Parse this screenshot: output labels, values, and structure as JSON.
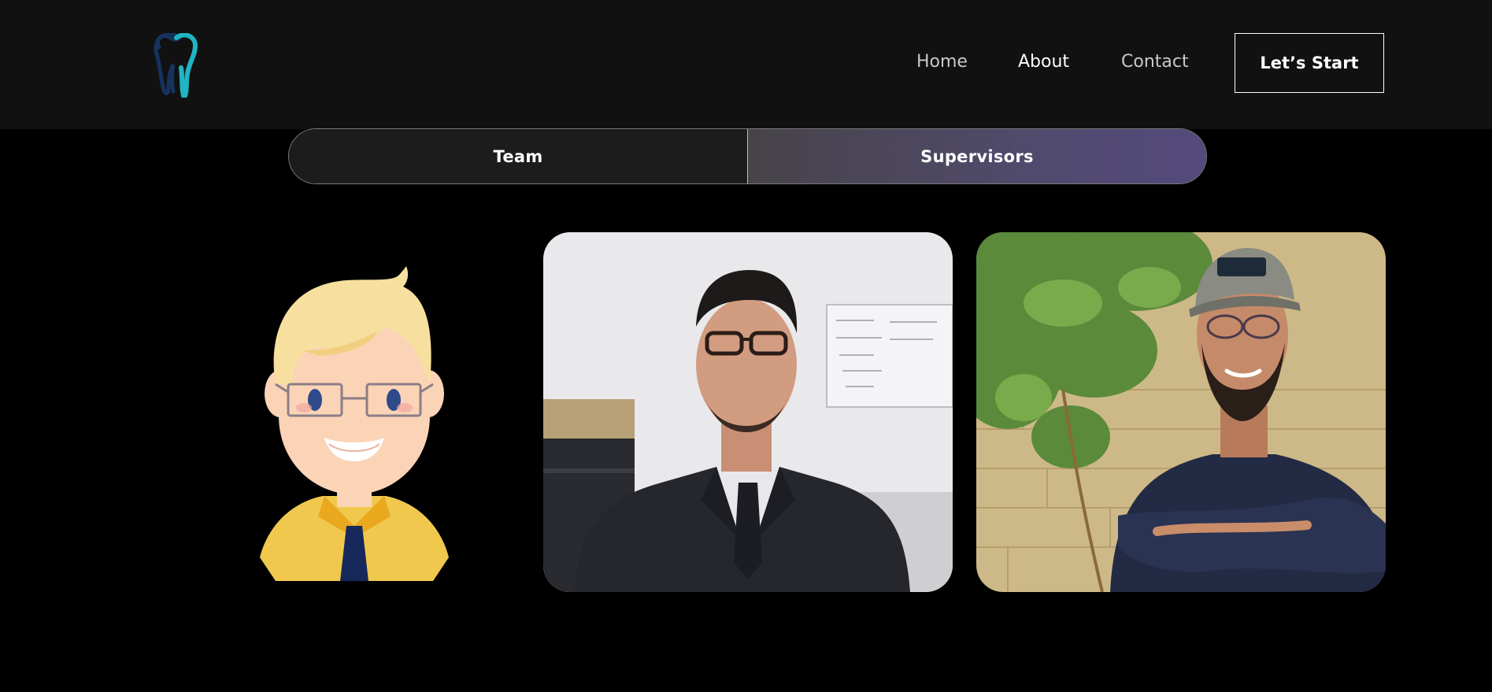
{
  "header": {
    "logo_icon": "tooth-icon",
    "nav": [
      {
        "label": "Home"
      },
      {
        "label": "About"
      },
      {
        "label": "Contact"
      }
    ],
    "cta_label": "Let’s Start"
  },
  "tabs": [
    {
      "label": "Team"
    },
    {
      "label": "Supervisors"
    }
  ],
  "colors": {
    "background": "#000000",
    "header": "#111111",
    "accent_teal": "#1fb5c3",
    "accent_navy": "#1a2a5c",
    "tab_active_gradient_end": "#544a7c"
  }
}
